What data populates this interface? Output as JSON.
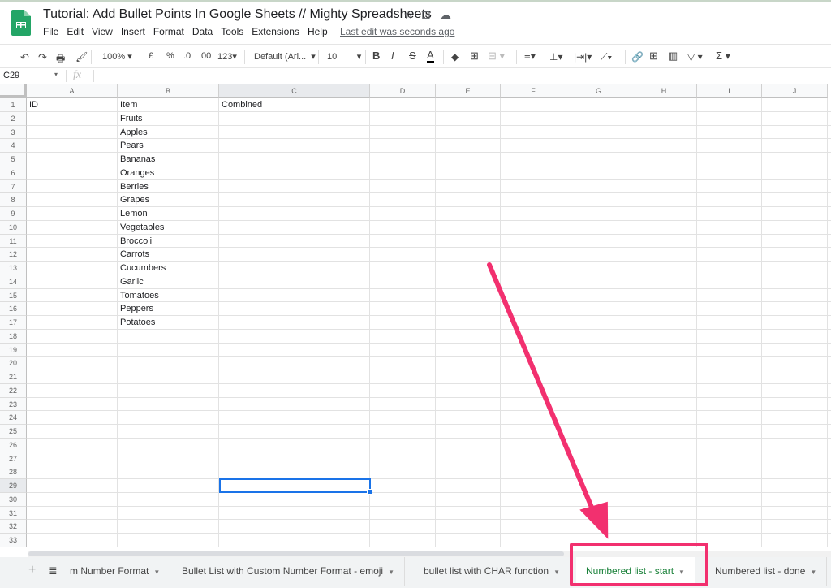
{
  "header": {
    "title": "Tutorial: Add Bullet Points In Google Sheets // Mighty Spreadsheets",
    "last_edit": "Last edit was seconds ago",
    "menu": [
      "File",
      "Edit",
      "View",
      "Insert",
      "Format",
      "Data",
      "Tools",
      "Extensions",
      "Help"
    ]
  },
  "toolbar": {
    "zoom": "100%",
    "currency": "£",
    "percent": "%",
    "dec_less": ".0",
    "dec_more": ".00",
    "format_more": "123",
    "font": "Default (Ari...",
    "font_size": "10",
    "bold": "B",
    "italic": "I",
    "strike": "S",
    "text_color": "A",
    "sum": "Σ"
  },
  "formula_bar": {
    "cell_ref": "C29",
    "fx": "fx",
    "value": ""
  },
  "columns": [
    "A",
    "B",
    "C",
    "D",
    "E",
    "F",
    "G",
    "H",
    "I",
    "J"
  ],
  "selected_cell": "C29",
  "rows": [
    [
      "ID",
      "Item",
      "Combined"
    ],
    [
      "",
      "Fruits"
    ],
    [
      "",
      "Apples"
    ],
    [
      "",
      "Pears"
    ],
    [
      "",
      "Bananas"
    ],
    [
      "",
      "Oranges"
    ],
    [
      "",
      "Berries"
    ],
    [
      "",
      "Grapes"
    ],
    [
      "",
      "Lemon"
    ],
    [
      "",
      "Vegetables"
    ],
    [
      "",
      "Broccoli"
    ],
    [
      "",
      "Carrots"
    ],
    [
      "",
      "Cucumbers"
    ],
    [
      "",
      "Garlic"
    ],
    [
      "",
      "Tomatoes"
    ],
    [
      "",
      "Peppers"
    ],
    [
      "",
      "Potatoes"
    ]
  ],
  "row_count": 33,
  "sheet_tabs": [
    {
      "label": "m Number Format"
    },
    {
      "label": "Bullet List with Custom Number Format - emoji"
    },
    {
      "label": "bullet list with CHAR function"
    },
    {
      "label": "Numbered list - start",
      "active": true
    },
    {
      "label": "Numbered list - done"
    }
  ],
  "colors": {
    "accent": "#188038",
    "selection": "#1a73e8",
    "annotation": "#f2306f"
  }
}
